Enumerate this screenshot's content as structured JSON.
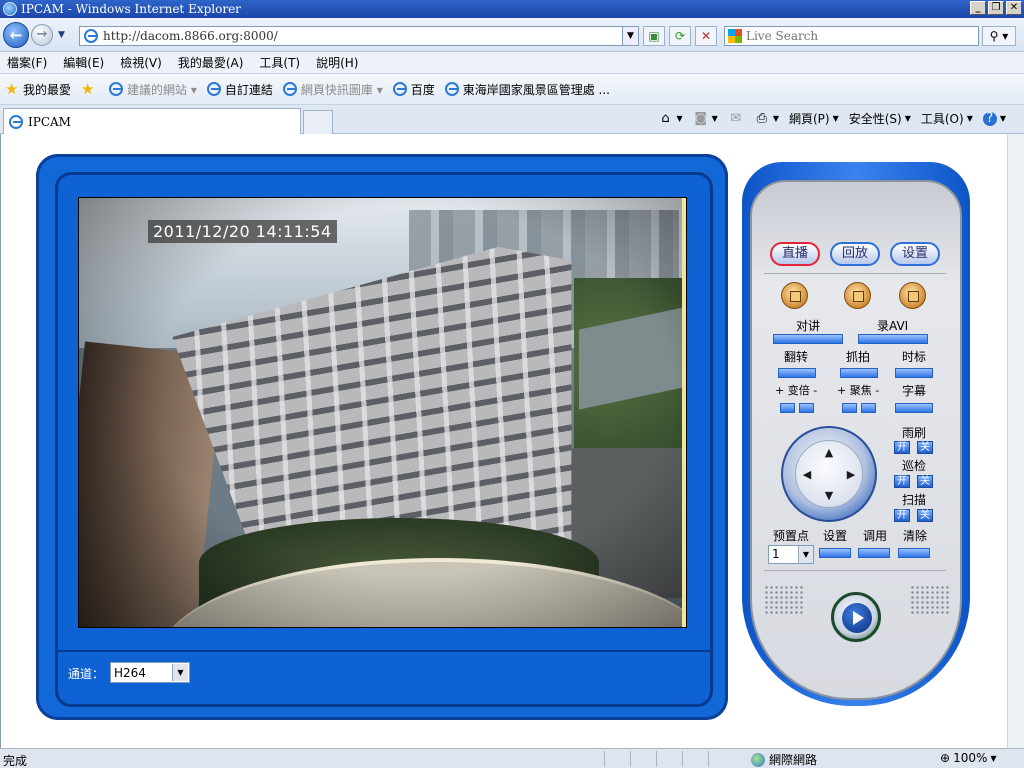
{
  "window": {
    "title": "IPCAM - Windows Internet Explorer",
    "buttons": [
      "_",
      "❐",
      "✕"
    ]
  },
  "address": {
    "url": "http://dacom.8866.org:8000/",
    "search_placeholder": "Live Search"
  },
  "menu": [
    "檔案(F)",
    "編輯(E)",
    "檢視(V)",
    "我的最愛(A)",
    "工具(T)",
    "說明(H)"
  ],
  "favorites": {
    "label": "我的最愛",
    "items": [
      {
        "label": "建議的網站 ▾",
        "muted": true
      },
      {
        "label": "自訂連結",
        "muted": false
      },
      {
        "label": "網頁快訊圖庫 ▾",
        "muted": true
      },
      {
        "label": "百度",
        "muted": false
      },
      {
        "label": "東海岸國家風景區管理處 ...",
        "muted": false
      }
    ]
  },
  "tab": {
    "title": "IPCAM"
  },
  "commands": {
    "page": "網頁(P)",
    "safety": "安全性(S)",
    "tools": "工具(O)"
  },
  "video": {
    "timestamp": "2011/12/20 14:11:54"
  },
  "channel": {
    "label": "通道：",
    "value": "H264"
  },
  "panel": {
    "modes": {
      "live": "直播",
      "playback": "回放",
      "settings": "设置"
    },
    "talk": "对讲",
    "record": "录AVI",
    "flip": "翻转",
    "snapshot": "抓拍",
    "timestamp": "时标",
    "zoom": "+ 变倍 -",
    "focus": "+ 聚焦 -",
    "osd": "字幕",
    "wiper": "雨刷",
    "cruise": "巡检",
    "scan": "扫描",
    "on": "开",
    "off": "关",
    "preset": "预置点",
    "preset_value": "1",
    "set": "设置",
    "call": "调用",
    "clear": "清除"
  },
  "status": {
    "text": "完成",
    "zone": "網際網路",
    "zoom": "100%"
  }
}
